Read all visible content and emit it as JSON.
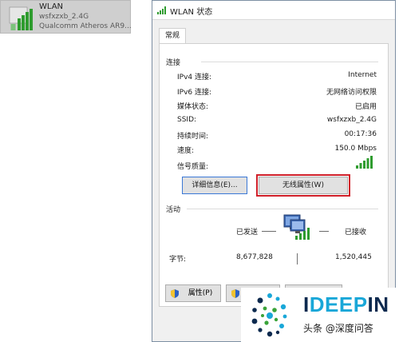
{
  "network_tile": {
    "name": "WLAN",
    "ssid": "wsfxzxb_2.4G",
    "adapter": "Qualcomm Atheros AR9..."
  },
  "dialog": {
    "title": "WLAN 状态",
    "tab": "常规",
    "connection": {
      "header": "连接",
      "rows": [
        {
          "label": "IPv4 连接:",
          "value": "Internet"
        },
        {
          "label": "IPv6 连接:",
          "value": "无网络访问权限"
        },
        {
          "label": "媒体状态:",
          "value": "已启用"
        },
        {
          "label": "SSID:",
          "value": "wsfxzxb_2.4G"
        },
        {
          "label": "持续时间:",
          "value": "00:17:36"
        },
        {
          "label": "速度:",
          "value": "150.0 Mbps"
        },
        {
          "label": "信号质量:",
          "value": ""
        }
      ],
      "signal_icon": "signal-bars-icon"
    },
    "buttons": {
      "details": "详细信息(E)...",
      "wireless_properties": "无线属性(W)"
    },
    "activity": {
      "header": "活动",
      "sent_label": "已发送",
      "received_label": "已接收",
      "bytes_label": "字节:",
      "bytes_sent": "8,677,828",
      "bytes_received": "1,520,445"
    },
    "bottom_buttons": {
      "properties": "属性(P)"
    }
  },
  "watermark": {
    "brand_prefix": "I",
    "brand_highlight": "DEEP",
    "brand_suffix": "IN",
    "caption": "头条 @深度问答"
  },
  "colors": {
    "highlight_border": "#d0202a",
    "signal_green": "#2f9c2f",
    "tile_bg": "#cfcfcf"
  }
}
